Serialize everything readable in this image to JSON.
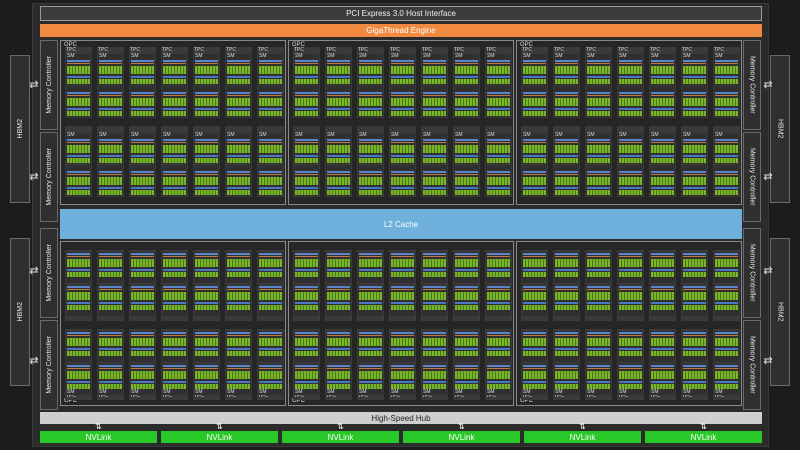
{
  "pcie": "PCI Express 3.0 Host Interface",
  "gigathread": "GigaThread Engine",
  "l2": "L2 Cache",
  "hub": "High-Speed Hub",
  "nvlink": [
    "NVLink",
    "NVLink",
    "NVLink",
    "NVLink",
    "NVLink",
    "NVLink"
  ],
  "memory_controller": "Memory Controller",
  "hbm": "HBM2",
  "gpc": "GPC",
  "tpc": "TPC",
  "sm": "SM",
  "arrow_glyph": "⇄",
  "colors": {
    "host_interface": "#3c3c3c",
    "gigathread": "#f08a40",
    "l2_cache": "#6fb0dc",
    "nvlink": "#28c828",
    "hub": "#cfcfcf",
    "cuda_cores": "#7ab52a"
  }
}
